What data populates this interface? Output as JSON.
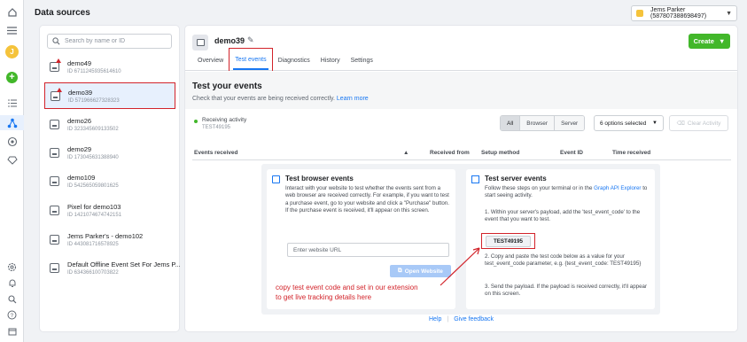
{
  "header": {
    "title": "Data sources",
    "account": "Jems Parker (587807388698497)"
  },
  "rail": {
    "avatar_letter": "J",
    "add_symbol": "+"
  },
  "search": {
    "placeholder": "Search by name or ID"
  },
  "data_sources": [
    {
      "name": "demo49",
      "id": "ID 671124593561461​0"
    },
    {
      "name": "demo39",
      "id": "ID 571966627328323"
    },
    {
      "name": "demo26",
      "id": "ID 323345609133502"
    },
    {
      "name": "demo29",
      "id": "ID 173045631388940"
    },
    {
      "name": "demo109",
      "id": "ID 542565059801625"
    },
    {
      "name": "Pixel for demo103",
      "id": "ID 142107467474215​1"
    },
    {
      "name": "Jems Parker's - demo102",
      "id": "ID 443081716578925"
    },
    {
      "name": "Default Offline Event Set For Jems P...",
      "id": "ID 634366100703822"
    }
  ],
  "main": {
    "pixel_name": "demo39",
    "create_label": "Create",
    "tabs": [
      "Overview",
      "Test events",
      "Diagnostics",
      "History",
      "Settings"
    ],
    "section_title": "Test your events",
    "section_desc": "Check that your events are being received correctly.",
    "learn_more": "Learn more",
    "status_label": "Receiving activity",
    "status_code": "TEST49195",
    "filters": [
      "All",
      "Browser",
      "Server"
    ],
    "options_selected": "6 options selected",
    "clear_label": "Clear Activity",
    "columns": [
      "Events received",
      "Received from",
      "Setup method",
      "Event ID",
      "Time received"
    ]
  },
  "browser_card": {
    "title": "Test browser events",
    "text": "Interact with your website to test whether the events sent from a web browser are received correctly. For example, if you want to test a purchase event, go to your website and click a \"Purchase\" button. If the purchase event is received, it'll appear on this screen.",
    "url_placeholder": "Enter website URL",
    "open_label": "Open Website"
  },
  "server_card": {
    "title": "Test server events",
    "intro": "Follow these steps on your terminal or in the",
    "intro_link": "Graph API Explorer",
    "intro_end": "to start seeing activity.",
    "step1": "1. Within your server's payload, add the 'test_event_code' to the event that you want to test.",
    "code": "TEST49195",
    "step2": "2. Copy and paste the test code below as a value for your test_event_code parameter, e.g. {test_event_code: TEST49195}",
    "step3": "3. Send the payload. If the payload is received correctly, it'll appear on this screen."
  },
  "footer": {
    "help": "Help",
    "feedback": "Give feedback"
  },
  "annotation": {
    "line1": "copy test event code and set in our extension",
    "line2": "to get live tracking details here"
  },
  "colors": {
    "accent": "#1877f2",
    "create": "#42b72a",
    "highlight": "#d2232a"
  }
}
